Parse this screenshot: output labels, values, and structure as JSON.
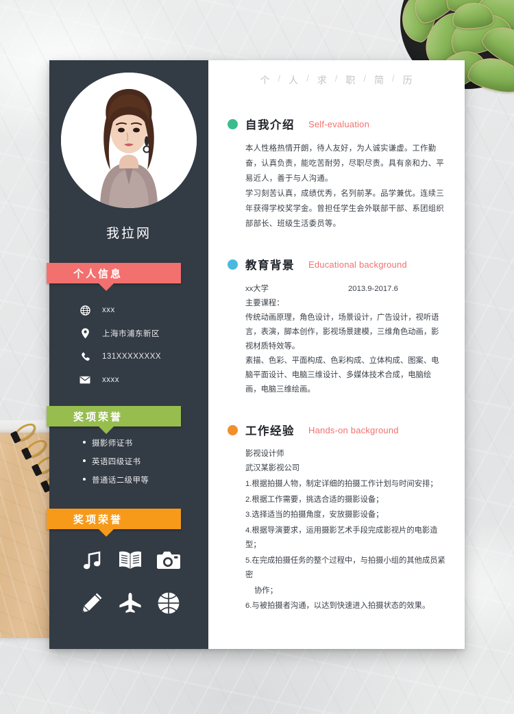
{
  "theme": {
    "sidebar_bg": "#333b44",
    "page_bg": "#ffffff",
    "pink": "#f2706e",
    "green": "#97bd4f",
    "orange": "#f79a1a",
    "dot_self": "#3cbc8d",
    "dot_edu": "#4bb8e0",
    "dot_work": "#ef8f2e",
    "accent_en": "#f2716e"
  },
  "topbar": {
    "chars": [
      "个",
      "人",
      "求",
      "职",
      "简",
      "历"
    ],
    "separator": "/"
  },
  "sidebar": {
    "photo_alt": "portrait-photo",
    "name": "我拉网",
    "personal_info": {
      "title": "个人信息",
      "items": [
        {
          "icon": "globe-icon",
          "value": "xxx"
        },
        {
          "icon": "location-pin-icon",
          "value": "上海市浦东新区"
        },
        {
          "icon": "phone-icon",
          "value": "131XXXXXXXX"
        },
        {
          "icon": "envelope-icon",
          "value": "xxxx"
        }
      ]
    },
    "awards": {
      "title": "奖项荣誉",
      "items": [
        "摄影师证书",
        "英语四级证书",
        "普通话二级甲等"
      ]
    },
    "hobbies": {
      "title": "奖项荣誉",
      "icons": [
        "music-note-icon",
        "open-book-icon",
        "camera-icon",
        "pencil-icon",
        "airplane-icon",
        "basketball-icon"
      ]
    }
  },
  "main": {
    "self_evaluation": {
      "title_cn": "自我介绍",
      "title_en": "Self-evaluation",
      "paragraphs": [
        "本人性格热情开朗，待人友好，为人诚实谦虚。工作勤奋，认真负责，能吃苦耐劳，尽职尽责。具有亲和力、平易近人，善于与人沟通。",
        "学习刻苦认真，成绩优秀，名列前茅。品学兼优。连续三年获得学校奖学金。曾担任学生会外联部干部、系团组织部部长、班级生活委员等。"
      ]
    },
    "education": {
      "title_cn": "教育背景",
      "title_en": "Educational background",
      "school": "xx大学",
      "date": "2013.9-2017.6",
      "courses_label": "主要课程：",
      "courses": [
        "传统动画原理，角色设计，场景设计，广告设计，视听语言，表演，脚本创作，影视场景建模，三维角色动画，影视材质特效等。",
        "素描、色彩、平面构成、色彩构成、立体构成、图案、电脑平面设计、电脑三维设计、多媒体技术合成，电脑绘画，电脑三维绘画。"
      ]
    },
    "work": {
      "title_cn": "工作经验",
      "title_en": "Hands-on background",
      "position": "影视设计师",
      "company": "武汉某影视公司",
      "duties": [
        "1.根据拍摄人物，制定详细的拍摄工作计划与时间安排；",
        "2.根据工作需要，挑选合适的摄影设备；",
        "3.选择适当的拍摄角度，安放摄影设备；",
        "4.根据导演要求，运用摄影艺术手段完成影视片的电影造型；",
        "5.在完成拍摄任务的整个过程中，与拍摄小组的其他成员紧密",
        "协作；",
        "6.与被拍摄者沟通，以达到快速进入拍摄状态的效果。"
      ]
    }
  }
}
